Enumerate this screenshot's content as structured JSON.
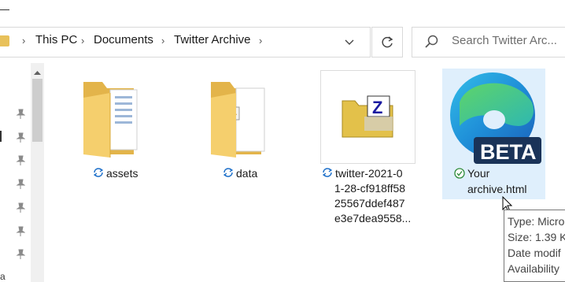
{
  "breadcrumb": [
    "This PC",
    "Documents",
    "Twitter Archive"
  ],
  "search_placeholder": "Search Twitter Arc...",
  "items": [
    {
      "name": "assets",
      "status": "sync"
    },
    {
      "name": "data",
      "status": "sync"
    },
    {
      "name_lines": [
        "twitter-2021-0",
        "1-28-cf918ff58",
        "25567ddef487",
        "e3e7dea9558..."
      ],
      "status": "sync"
    },
    {
      "name_lines": [
        "Your",
        "archive.html"
      ],
      "status": "available",
      "badge": "BETA"
    }
  ],
  "tooltip": {
    "type": "Type: Micro",
    "size": "Size: 1.39 K",
    "date": "Date modif",
    "availability": "Availability"
  },
  "icons": {
    "folder": "folder-icon",
    "zip": "zip-file-icon",
    "edge": "edge-beta-icon",
    "sync": "sync-icon",
    "check": "check-circle-icon",
    "pin": "pin-icon",
    "refresh": "refresh-icon",
    "search": "search-icon"
  },
  "colors": {
    "selection": "#dfeffc",
    "sync": "#1c6fc9",
    "available": "#2e8b3a"
  }
}
